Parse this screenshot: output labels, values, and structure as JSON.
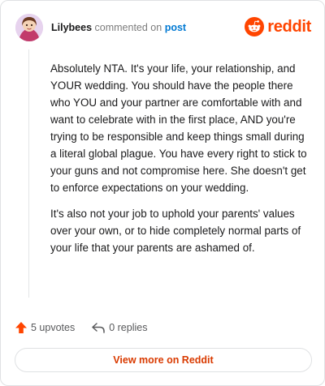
{
  "comment": {
    "author": "Lilybees",
    "action_text": "commented on",
    "post_link_text": "post",
    "paragraphs": [
      "Absolutely NTA. It's your life, your relationship, and YOUR wedding. You should have the people there who YOU and your partner are comfortable with and want to celebrate with in the first place, AND you're trying to be responsible and keep things small during a literal global plague. You have every right to stick to your guns and not compromise here. She doesn't get to enforce expectations on your wedding.",
      "It's also not your job to uphold your parents' values over your own, or to hide completely normal parts of your life that your parents are ashamed of."
    ]
  },
  "brand": {
    "name": "reddit",
    "icon": "reddit-snoo-icon",
    "color": "#ff4500"
  },
  "stats": {
    "upvotes_label": "5 upvotes",
    "replies_label": "0 replies",
    "upvote_icon": "upvote-arrow-icon",
    "reply_icon": "reply-arrow-icon",
    "upvote_color": "#ff4500"
  },
  "footer": {
    "view_more_label": "View more on Reddit"
  }
}
